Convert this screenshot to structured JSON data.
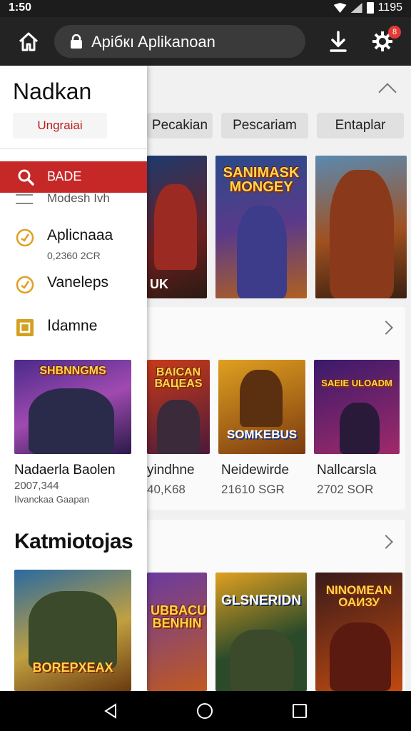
{
  "status_bar": {
    "time": "1:50",
    "right_text": "1195"
  },
  "toolbar": {
    "url_text": "Apiбкı Aplikanoan",
    "badge": "8",
    "icons": [
      "home-icon",
      "lock-icon",
      "download-icon",
      "gear-icon"
    ]
  },
  "main": {
    "chips": [
      "Pecakian",
      "Pescariam",
      "Entaplar"
    ],
    "top_row_caption": "UK",
    "row2": {
      "games": [
        {
          "title": "yindhne",
          "meta": "40,K68",
          "banner": "BAICAN ВАЦЕАS"
        },
        {
          "title": "Neidewirde",
          "meta": "21610 SGR",
          "banner": "SOMKEBUS"
        },
        {
          "title": "Nallcarsla",
          "meta": "2702 SOR",
          "banner": "SAEIE ULOADM"
        }
      ]
    },
    "row1_banners": [
      "SANIMASK MONGEY"
    ],
    "row3_banners": [
      "UBBACU BENHIN",
      "GLSNERIDN",
      "NINOMEAN ОАИЗУ"
    ]
  },
  "drawer": {
    "title": "Nadkan",
    "sub_button": "Ungraiai",
    "active_item": "ВАDE",
    "cut_item": "Modesh Ivh",
    "items": [
      {
        "label": "Aplicnaaa",
        "sub": "0,2360 2CR",
        "icon": "check-circle-icon"
      },
      {
        "label": "Vaneleps",
        "sub": "",
        "icon": "check-circle-icon"
      },
      {
        "label": "Ⅰdamne",
        "sub": "",
        "icon": "grid-badge-icon"
      }
    ],
    "featured": {
      "banner": "SHBNNGMS",
      "title": "Nadaerla Baolen",
      "meta1": "2007,344",
      "meta2": "Ⅰlvanckaa Gaapan"
    },
    "section_title": "Katmiotojas",
    "section_card_banner": "BOREPXEAX"
  },
  "colors": {
    "accent": "#c62828",
    "toolbar": "#232323"
  }
}
